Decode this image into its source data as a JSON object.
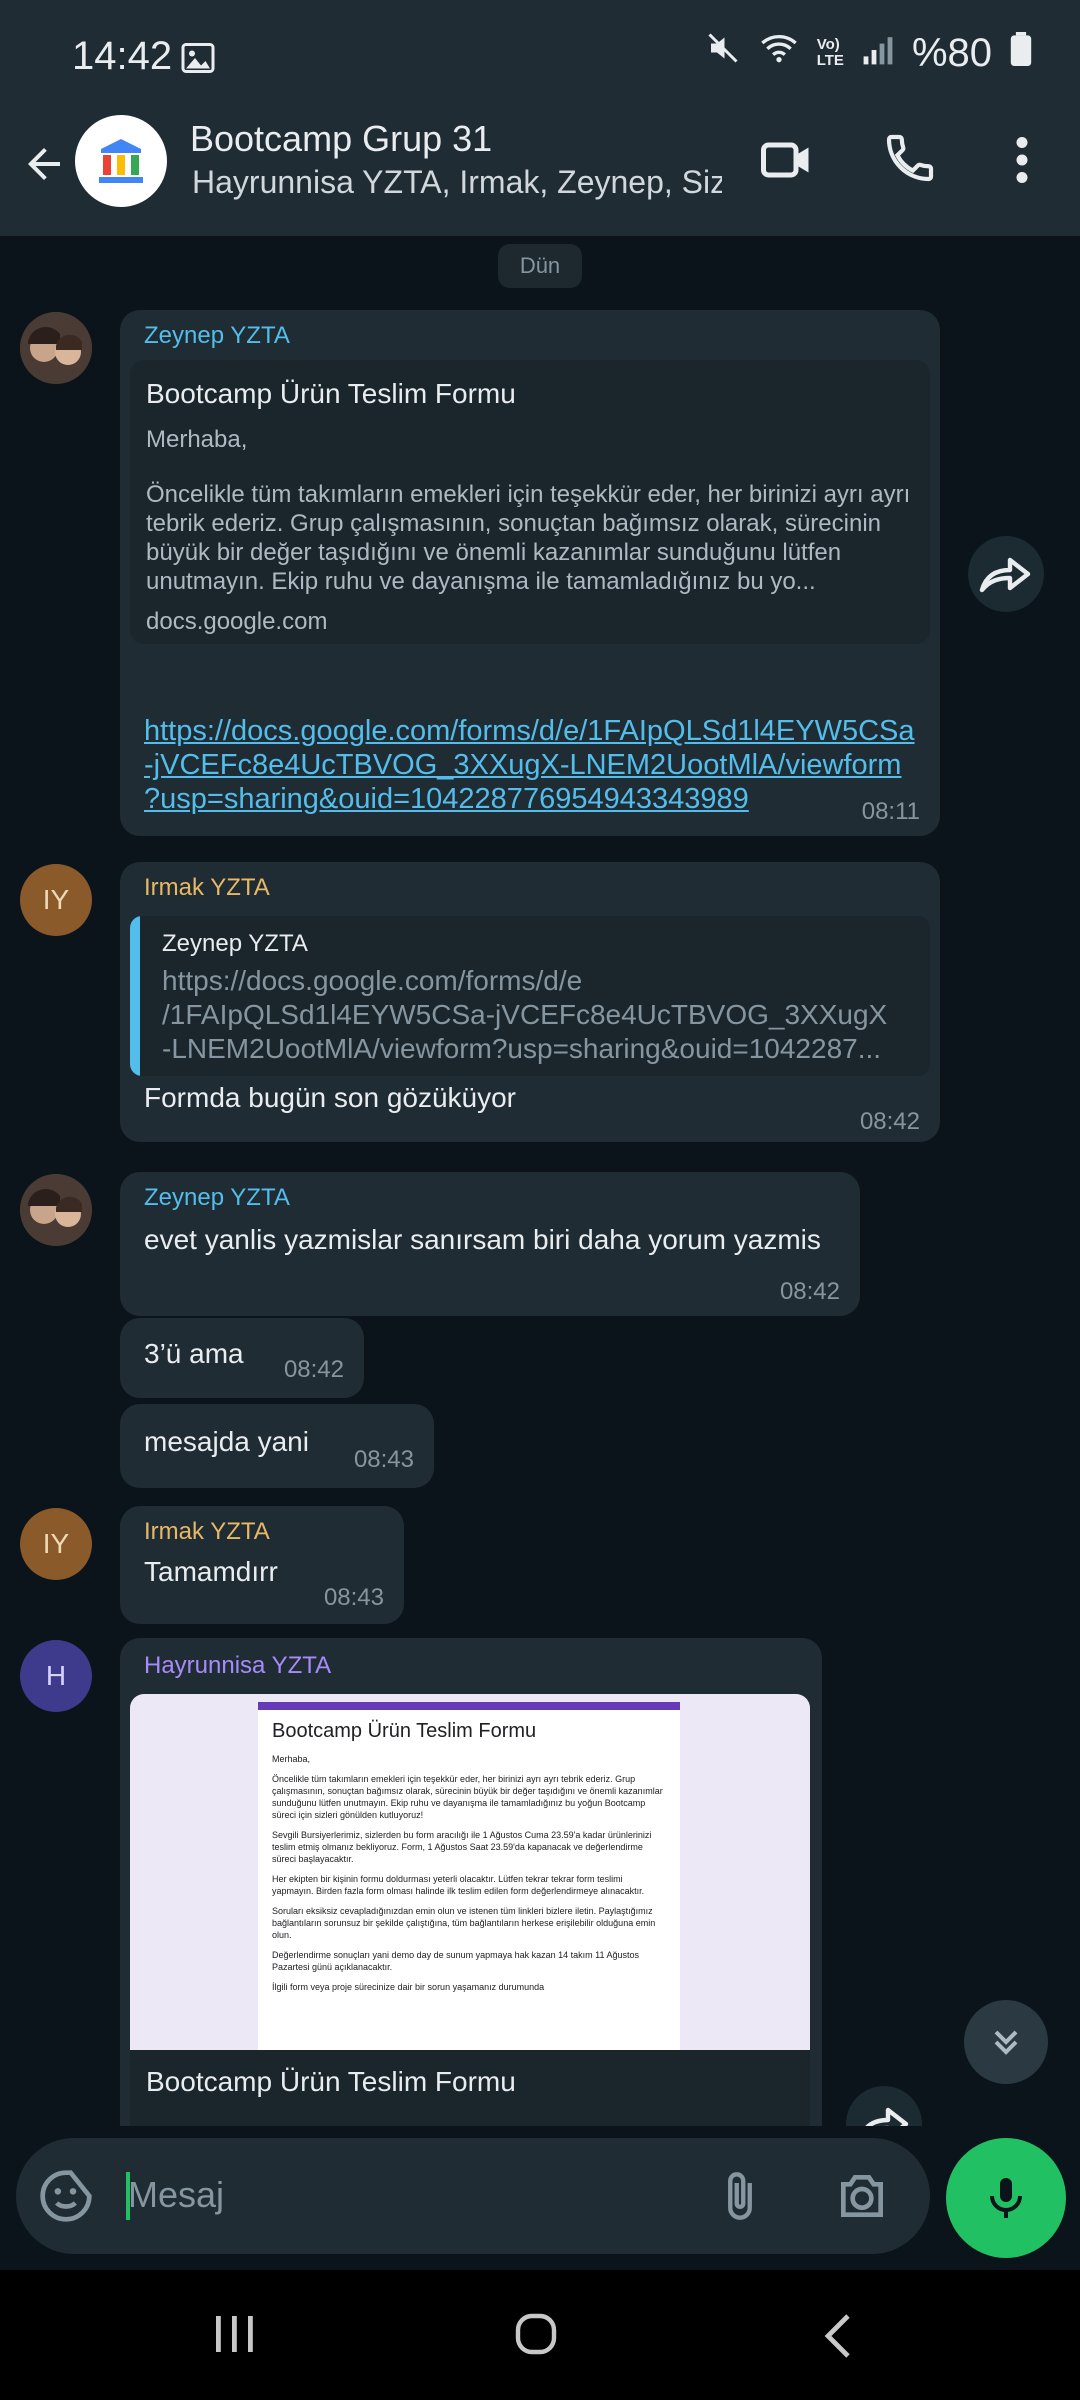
{
  "status_bar": {
    "time": "14:42",
    "battery": "%80"
  },
  "header": {
    "title": "Bootcamp Grup 31",
    "subtitle": "Hayrunnisa YZTA, Irmak, Zeynep, Siz"
  },
  "chat": {
    "date_chip": "Dün",
    "msg1": {
      "sender": "Zeynep YZTA",
      "card_title": "Bootcamp Ürün Teslim Formu",
      "card_greeting": "Merhaba,",
      "card_body": "Öncelikle tüm takımların emekleri için teşekkür eder, her birinizi ayrı ayrı tebrik ederiz. Grup çalışmasının, sonuçtan bağımsız olarak, sürecinin büyük bir değer taşıdığını ve önemli kazanımlar sunduğunu lütfen unutmayın. Ekip ruhu ve dayanışma ile tamamladığınız bu yo...",
      "card_domain": "docs.google.com",
      "link_line1": "https://docs.google.com/forms/d/e/1FAIpQLSd1l4EYW5CSa",
      "link_line2": "-jVCEFc8e4UcTBVOG_3XXugX-LNEM2UootMlA/viewform",
      "link_line3": "?usp=sharing&ouid=104228776954943343989",
      "time": "08:11"
    },
    "msg2": {
      "avatar": "IY",
      "sender": "Irmak YZTA",
      "quote_sender": "Zeynep YZTA",
      "quote_line1": "https://docs.google.com/forms/d/e",
      "quote_line2": "/1FAIpQLSd1l4EYW5CSa-jVCEFc8e4UcTBVOG_3XXugX",
      "quote_line3": "-LNEM2UootMlA/viewform?usp=sharing&ouid=1042287...",
      "text": "Formda bugün son gözüküyor",
      "time": "08:42"
    },
    "msg3": {
      "sender": "Zeynep YZTA",
      "text": "evet yanlis yazmislar sanırsam biri daha yorum yazmis",
      "time": "08:42"
    },
    "msg4": {
      "text": "3’ü ama",
      "time": "08:42"
    },
    "msg5": {
      "text": "mesajda yani",
      "time": "08:43"
    },
    "msg6": {
      "avatar": "IY",
      "sender": "Irmak YZTA",
      "text": "Tamamdırr",
      "time": "08:43"
    },
    "msg7": {
      "avatar": "H",
      "sender": "Hayrunnisa YZTA",
      "doc": {
        "title": "Bootcamp Ürün Teslim Formu",
        "p1": "Merhaba,",
        "p2": "Öncelikle tüm takımların emekleri için teşekkür eder, her birinizi ayrı ayrı tebrik ederiz. Grup çalışmasının, sonuçtan bağımsız olarak, sürecinin büyük bir değer taşıdığını ve önemli kazanımlar sunduğunu lütfen unutmayın. Ekip ruhu ve dayanışma ile tamamladığınız bu yoğun Bootcamp süreci için sizleri gönülden kutluyoruz!",
        "p3": "Sevgili Bursiyerlerimiz, sizlerden bu form aracılığı ile 1 Ağustos Cuma 23.59'a kadar ürünlerinizi teslim etmiş olmanız bekliyoruz. Form, 1 Ağustos Saat 23.59'da kapanacak ve değerlendirme süreci başlayacaktır.",
        "p4": "Her ekipten bir kişinin formu doldurması yeterli olacaktır. Lütfen tekrar tekrar form teslimi yapmayın. Birden fazla form olması halinde ilk teslim edilen form değerlendirmeye alınacaktır.",
        "p5": "Soruları eksiksiz cevapladığınızdan emin olun ve istenen tüm linkleri bizlere iletin. Paylaştığımız bağlantıların sorunsuz bir şekilde çalıştığına, tüm bağlantıların herkese erişilebilir olduğuna emin olun.",
        "p6": "Değerlendirme sonuçları yani demo day de sunum yapmaya hak kazan 14 takım 11 Ağustos Pazartesi günü açıklanacaktır.",
        "p7": "İlgili form veya proje sürecinize dair bir sorun yaşamanız durumunda"
      },
      "caption": "Bootcamp Ürün Teslim Formu"
    }
  },
  "composer": {
    "placeholder": "Mesaj"
  },
  "colors": {
    "accent_green": "#21c063",
    "link_blue": "#53bdeb",
    "sender_zeynep": "#53bdeb",
    "sender_irmak": "#e8b865",
    "sender_hayrunnisa": "#a78bfa"
  }
}
